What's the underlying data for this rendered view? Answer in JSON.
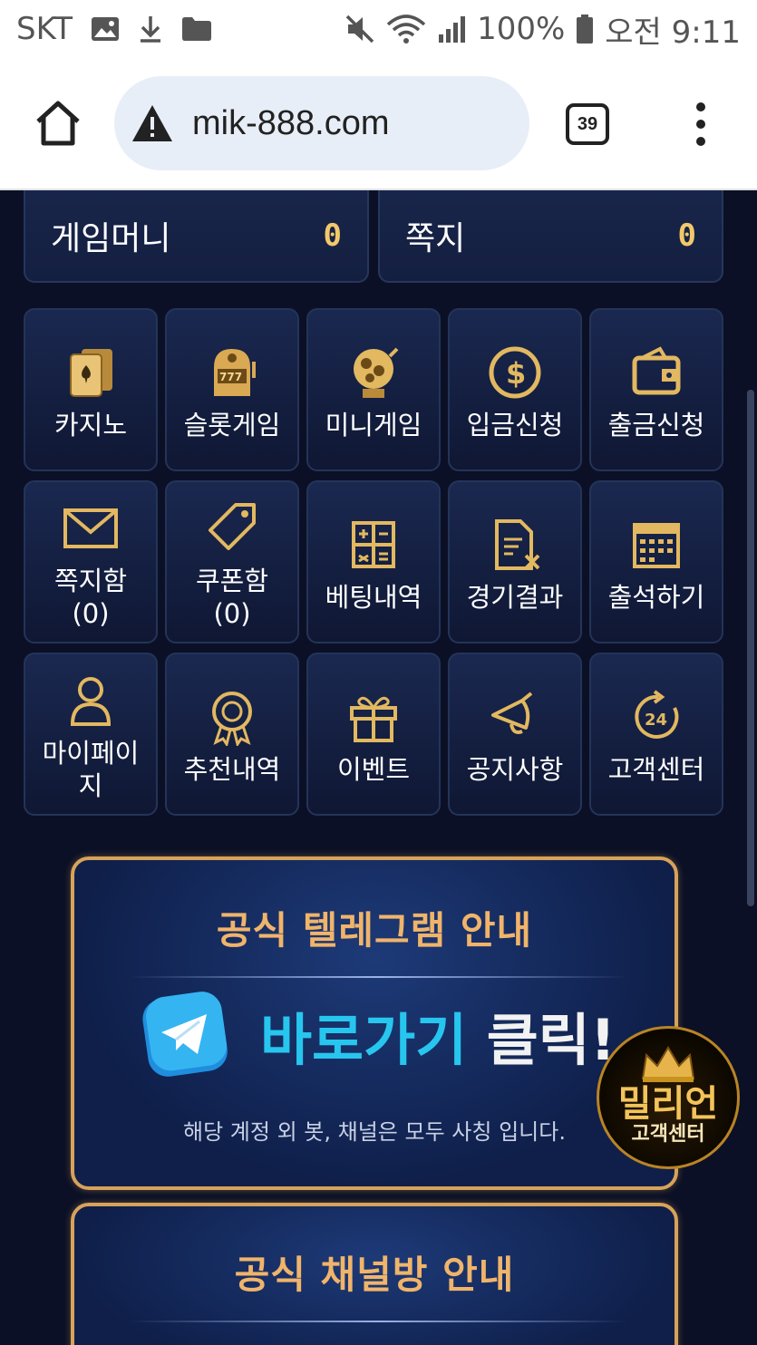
{
  "status_bar": {
    "carrier": "SKT",
    "battery": "100%",
    "time": "오전 9:11"
  },
  "browser": {
    "url": "mik-888.com",
    "tab_count": "39"
  },
  "account": {
    "game_money_label": "게임머니",
    "game_money_value": "0",
    "messages_label": "쪽지",
    "messages_value": "0"
  },
  "menu": [
    {
      "label": "카지노",
      "icon": "playing-cards-icon"
    },
    {
      "label": "슬롯게임",
      "icon": "slot-machine-icon"
    },
    {
      "label": "미니게임",
      "icon": "lottery-ball-icon"
    },
    {
      "label": "입금신청",
      "icon": "dollar-coin-icon"
    },
    {
      "label": "출금신청",
      "icon": "wallet-icon"
    },
    {
      "label": "쪽지함\n(0)",
      "icon": "envelope-icon"
    },
    {
      "label": "쿠폰함\n(0)",
      "icon": "coupon-tag-icon"
    },
    {
      "label": "베팅내역",
      "icon": "calculator-icon"
    },
    {
      "label": "경기결과",
      "icon": "document-result-icon"
    },
    {
      "label": "출석하기",
      "icon": "calendar-icon"
    },
    {
      "label": "마이페이\n지",
      "icon": "user-icon"
    },
    {
      "label": "추천내역",
      "icon": "award-badge-icon"
    },
    {
      "label": "이벤트",
      "icon": "gift-box-icon"
    },
    {
      "label": "공지사항",
      "icon": "bell-icon"
    },
    {
      "label": "고객센터",
      "icon": "support-24-icon"
    }
  ],
  "banners": {
    "telegram": {
      "title": "공식 텔레그램 안내",
      "cta_blue": "바로가기",
      "cta_white": "클릭!",
      "note": "해당 계정 외 봇, 채널은 모두 사칭 입니다."
    },
    "channel": {
      "title": "공식 채널방 안내"
    }
  },
  "support_badge": {
    "brand": "밀리언",
    "label": "고객센터"
  },
  "colors": {
    "accent_gold": "#f2c86a",
    "background": "#0b1026",
    "banner_border": "#d7a25a",
    "cta_cyan": "#27c6ee"
  }
}
